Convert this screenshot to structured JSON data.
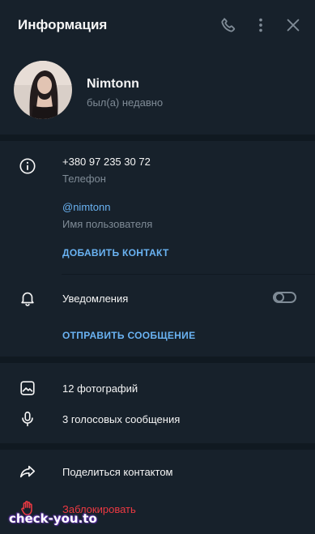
{
  "header": {
    "title": "Информация",
    "icons": [
      "phone-icon",
      "more-vertical-icon",
      "close-icon"
    ]
  },
  "profile": {
    "name": "Nimtonn",
    "status": "был(а) недавно"
  },
  "info": {
    "phone": "+380 97 235 30 72",
    "phone_label": "Телефон",
    "username": "@nimtonn",
    "username_label": "Имя пользователя",
    "add_contact": "ДОБАВИТЬ КОНТАКТ"
  },
  "notifications": {
    "label": "Уведомления",
    "enabled": false,
    "send_message": "ОТПРАВИТЬ СООБЩЕНИЕ"
  },
  "media": {
    "photos": "12 фотографий",
    "voice": "3 голосовых сообщения"
  },
  "actions": {
    "share": "Поделиться контактом",
    "block": "Заблокировать"
  },
  "watermark": "check-you.to",
  "colors": {
    "background": "#17212b",
    "separator": "#101921",
    "accent": "#6ab3f3",
    "muted": "#7f8b96",
    "danger": "#ec3942"
  }
}
